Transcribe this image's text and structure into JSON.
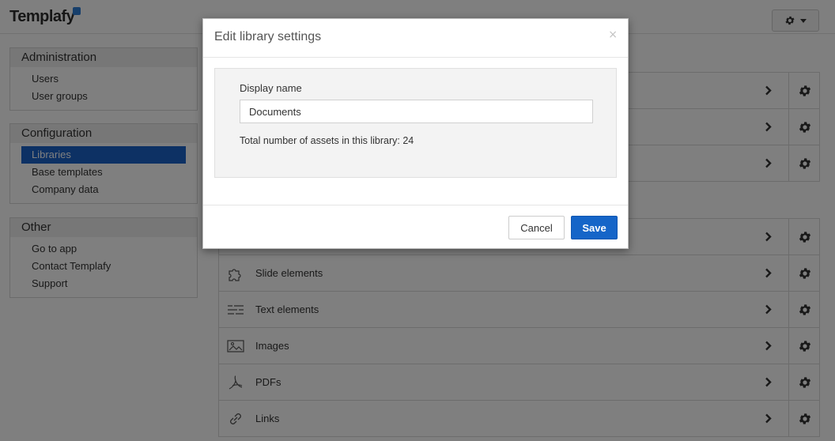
{
  "header": {
    "logo": "Templafy",
    "settings_icon": "gear-icon"
  },
  "sidebar": {
    "sections": [
      {
        "title": "Administration",
        "items": [
          {
            "label": "Users"
          },
          {
            "label": "User groups"
          }
        ]
      },
      {
        "title": "Configuration",
        "items": [
          {
            "label": "Libraries"
          },
          {
            "label": "Base templates"
          },
          {
            "label": "Company data"
          }
        ]
      },
      {
        "title": "Other",
        "items": [
          {
            "label": "Go to app"
          },
          {
            "label": "Contact Templafy"
          },
          {
            "label": "Support"
          }
        ]
      }
    ],
    "active_item": "Libraries"
  },
  "libraries": {
    "group_top": [
      {
        "label": "",
        "icon": "document-icon"
      },
      {
        "label": "",
        "icon": "document-icon"
      },
      {
        "label": "",
        "icon": "document-icon"
      }
    ],
    "group_bottom": [
      {
        "label": "",
        "icon": "document-icon"
      },
      {
        "label": "Slide elements",
        "icon": "puzzle-icon"
      },
      {
        "label": "Text elements",
        "icon": "text-lines-icon"
      },
      {
        "label": "Images",
        "icon": "image-icon"
      },
      {
        "label": "PDFs",
        "icon": "pdf-icon"
      },
      {
        "label": "Links",
        "icon": "link-icon"
      }
    ]
  },
  "modal": {
    "title": "Edit library settings",
    "close": "×",
    "display_name_label": "Display name",
    "display_name_value": "Documents",
    "assets_text": "Total number of assets in this library: 24",
    "cancel_label": "Cancel",
    "save_label": "Save"
  },
  "colors": {
    "accent": "#1565c8",
    "active_nav": "#1a63c9",
    "overlay": "rgba(0,0,0,0.5)"
  }
}
